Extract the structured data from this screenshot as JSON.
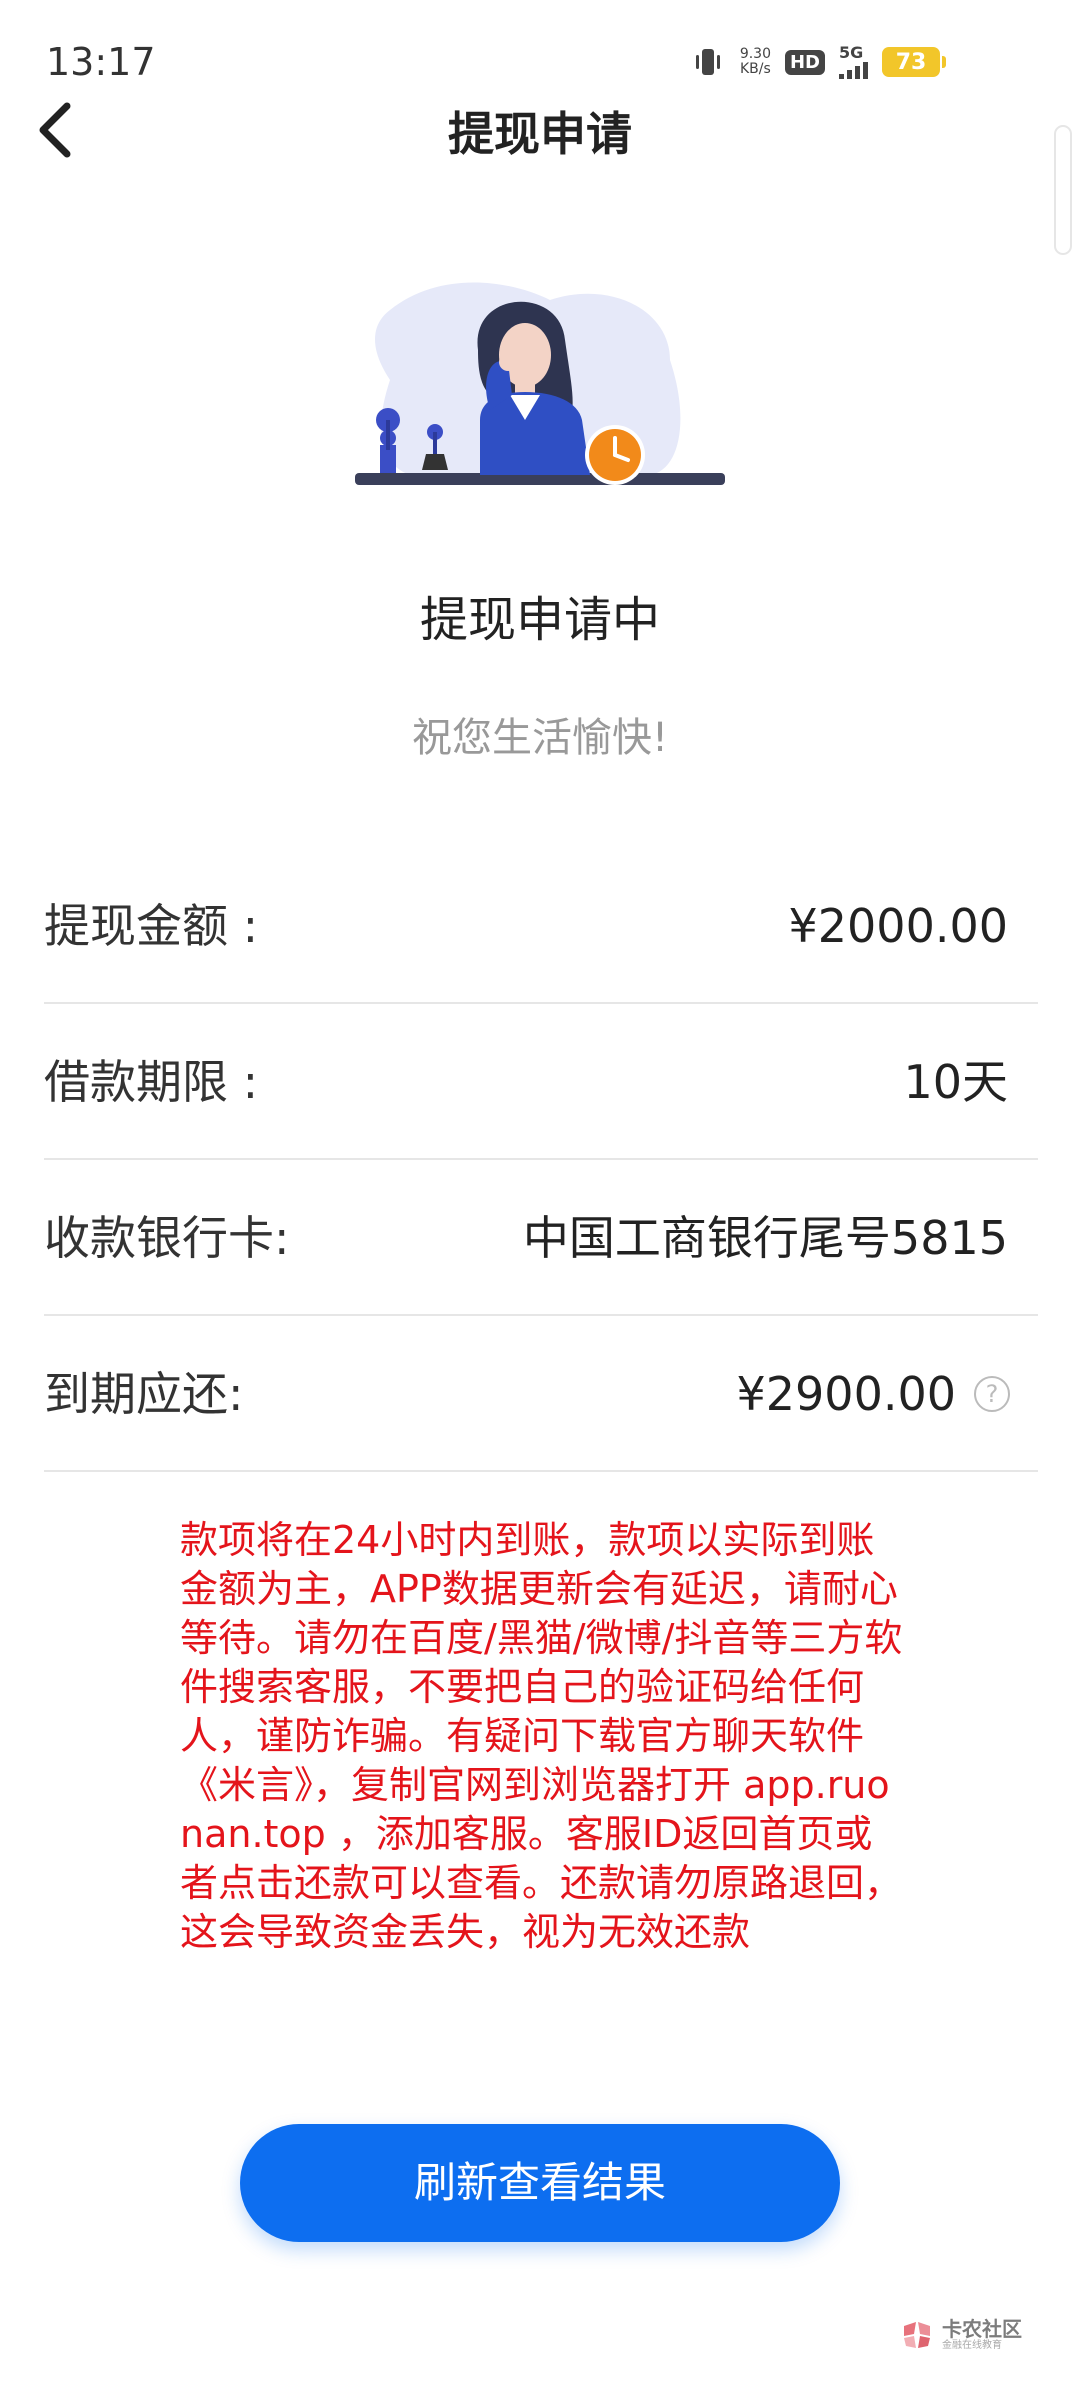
{
  "status_bar": {
    "time": "13:17",
    "net_speed_value": "9.30",
    "net_speed_unit": "KB/s",
    "hd_label": "HD",
    "network_label": "5G",
    "battery_level": "73"
  },
  "header": {
    "title": "提现申请"
  },
  "status": {
    "heading": "提现申请中",
    "greeting": "祝您生活愉快!"
  },
  "details": {
    "amount_label": "提现金额 :",
    "amount_value": "¥2000.00",
    "term_label": "借款期限 :",
    "term_value": "10天",
    "card_label": "收款银行卡:",
    "card_value": "中国工商银行尾号5815",
    "due_label": "到期应还:",
    "due_value": "¥2900.00",
    "help_icon": "?"
  },
  "notice": "款项将在24小时内到账，款项以实际到账金额为主，APP数据更新会有延迟，请耐心等待。请勿在百度/黑猫/微博/抖音等三方软件搜索客服，不要把自己的验证码给任何人，谨防诈骗。有疑问下载官方聊天软件《米言》，复制官网到浏览器打开 app.ruonan.top ，添加客服。客服ID返回首页或者点击还款可以查看。还款请勿原路退回，这会导致资金丢失，视为无效还款",
  "button": {
    "refresh_label": "刷新查看结果"
  },
  "watermark": {
    "main": "卡农社区",
    "sub": "金融在线教育"
  },
  "colors": {
    "primary": "#0d6ef0",
    "notice": "#e4141b",
    "muted": "#999999",
    "divider": "#e6e6e6",
    "battery": "#f2c62a"
  }
}
